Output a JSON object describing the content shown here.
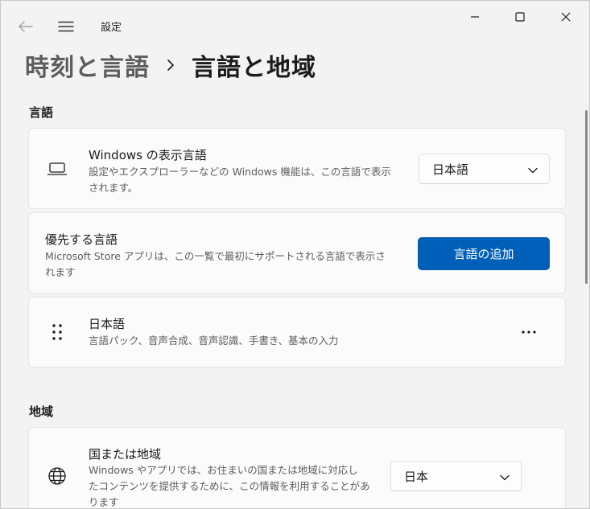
{
  "titlebar": {
    "app_title": "設定",
    "icons": [
      "back-arrow-icon",
      "hamburger-menu-icon",
      "minimize-icon",
      "maximize-icon",
      "close-icon"
    ]
  },
  "breadcrumb": {
    "parent": "時刻と言語",
    "current": "言語と地域"
  },
  "language_section": {
    "title": "言語",
    "display_language": {
      "icon": "laptop-icon",
      "title": "Windows の表示言語",
      "desc_line1": "設定やエクスプローラーなどの Windows 機能は、この言語で表示",
      "desc_line2": "されます。",
      "selected": "日本語"
    },
    "preferred": {
      "title": "優先する言語",
      "desc_line1": "Microsoft Store アプリは、この一覧で最初にサポートされる言語で表示さ",
      "desc_line2": "れます",
      "button": "言語の追加"
    },
    "installed": {
      "icon": "drag-handle-icon",
      "name": "日本語",
      "features": "言語パック、音声合成、音声認識、手書き、基本の入力",
      "more_icon": "more-options-icon"
    }
  },
  "region_section": {
    "title": "地域",
    "country": {
      "icon": "globe-icon",
      "title": "国または地域",
      "desc_line1": "Windows やアプリでは、お住まいの国または地域に対応し",
      "desc_line2": "たコンテンツを提供するために、この情報を利用することがあ",
      "desc_line3": "ります",
      "selected": "日本"
    }
  },
  "colors": {
    "accent": "#005fb8",
    "background": "#f3f3f3",
    "card": "#fbfbfb"
  }
}
